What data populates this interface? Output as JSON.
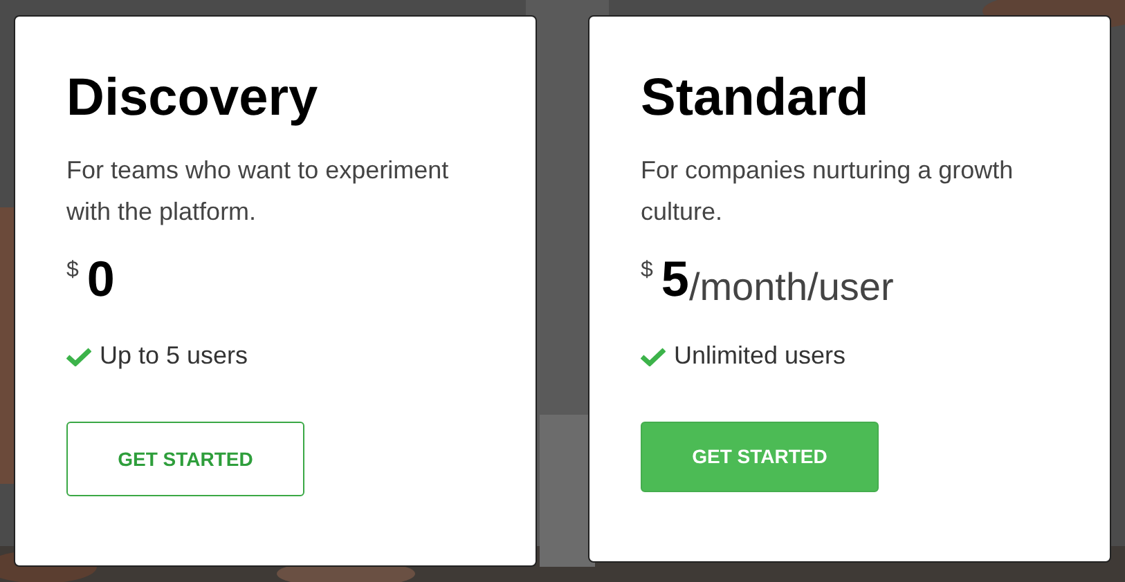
{
  "plans": [
    {
      "name": "Discovery",
      "description": "For teams who want to experiment with the platform.",
      "currency": "$",
      "price": "0",
      "features": [
        "Up to 5 users"
      ],
      "button": {
        "label": "GET STARTED",
        "kind": "outline"
      }
    },
    {
      "name": "Standard",
      "description": "For companies nurturing a growth culture.",
      "currency": "$",
      "price": "5",
      "period": "/month/user",
      "features": [
        "Unlimited users"
      ],
      "button": {
        "label": "GET STARTED",
        "kind": "filled"
      }
    }
  ]
}
